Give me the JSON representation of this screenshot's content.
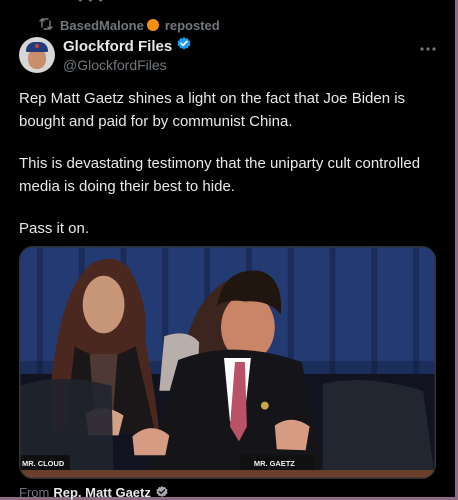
{
  "top": {
    "fragment": "• • •"
  },
  "repost": {
    "user": "BasedMalone",
    "action": "reposted",
    "badge_color": "#f4900c"
  },
  "author": {
    "name": "Glockford Files",
    "handle": "@GlockfordFiles",
    "verified_color": "#1d9bf0"
  },
  "post": {
    "paragraphs": [
      "Rep Matt Gaetz shines a light on the fact that Joe Biden is bought and paid for by communist China.",
      "This is devastating testimony that the uniparty cult controlled media is doing their best to hide.",
      "Pass it on."
    ]
  },
  "media": {
    "placard_left": "MR. CLOUD",
    "placard_right": "MR. GAETZ"
  },
  "footer": {
    "from_label": "From",
    "from_name": "Rep. Matt Gaetz"
  },
  "colors": {
    "background": "#000000",
    "text": "#e7e9ea",
    "secondary": "#71767b",
    "frame": "#8f6a86"
  },
  "icons": {
    "repost": "repost-icon",
    "badge": "orange-badge-icon",
    "verified": "verified-badge-icon",
    "more": "more-horizontal-icon",
    "gray_check": "gray-verified-icon"
  }
}
